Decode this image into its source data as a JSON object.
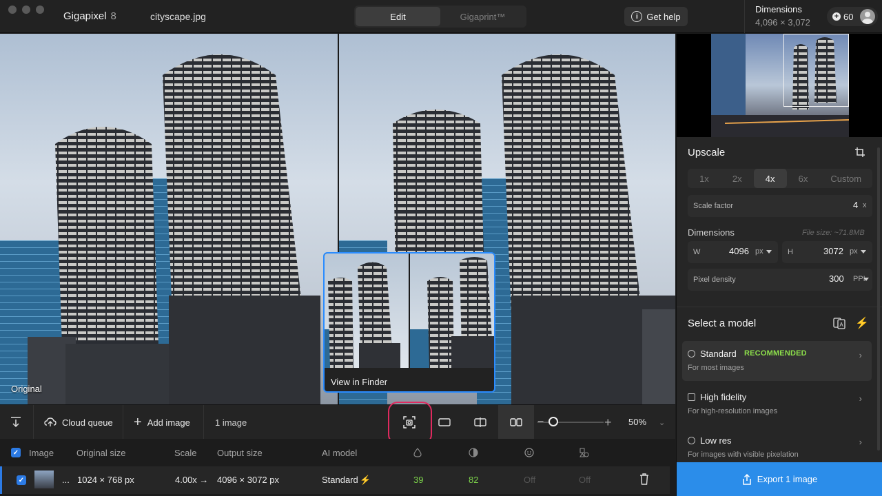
{
  "titlebar": {
    "app_name": "Gigapixel",
    "app_version": "8",
    "file_name": "cityscape.jpg",
    "tabs": [
      {
        "label": "Edit",
        "active": true
      },
      {
        "label": "Gigaprint™",
        "active": false
      }
    ],
    "help_label": "Get help",
    "dimensions_label": "Dimensions",
    "dimensions_value": "4,096 × 3,072",
    "credits": "60"
  },
  "viewer": {
    "original_label": "Original",
    "finder_caption": "View in Finder"
  },
  "toolbar": {
    "cloud_queue_label": "Cloud queue",
    "add_image_label": "Add image",
    "image_count": "1 image",
    "zoom_value": "50%",
    "zoom_level": 0.2
  },
  "table": {
    "headers": {
      "image": "Image",
      "original_size": "Original size",
      "scale": "Scale",
      "output_size": "Output size",
      "ai_model": "AI model"
    },
    "rows": [
      {
        "name": "...",
        "original_size": "1024 × 768 px",
        "scale": "4.00x →",
        "output_size": "4096 × 3072 px",
        "ai_model": "Standard",
        "v1": "39",
        "v2": "82",
        "v3": "Off",
        "v4": "Off"
      }
    ]
  },
  "panel": {
    "upscale_title": "Upscale",
    "scale_options": [
      "1x",
      "2x",
      "4x",
      "6x",
      "Custom"
    ],
    "scale_selected": "4x",
    "scale_factor_label": "Scale factor",
    "scale_factor_value": "4",
    "scale_factor_unit": "x",
    "dimensions_title": "Dimensions",
    "file_size": "File size: ~71.8MB",
    "width_label": "W",
    "width_value": "4096",
    "width_unit": "px",
    "height_label": "H",
    "height_value": "3072",
    "height_unit": "px",
    "density_label": "Pixel density",
    "density_value": "300",
    "density_unit": "PPI",
    "model_title": "Select a model",
    "models": [
      {
        "name": "Standard",
        "badge": "RECOMMENDED",
        "desc": "For most images"
      },
      {
        "name": "High fidelity",
        "desc": "For high-resolution images"
      },
      {
        "name": "Low res",
        "desc": "For images with visible pixelation"
      }
    ],
    "export_label": "Export 1 image"
  },
  "colors": {
    "accent": "#2b8dea",
    "highlight_ring": "#e02a5f",
    "recommended": "#8de04b"
  }
}
